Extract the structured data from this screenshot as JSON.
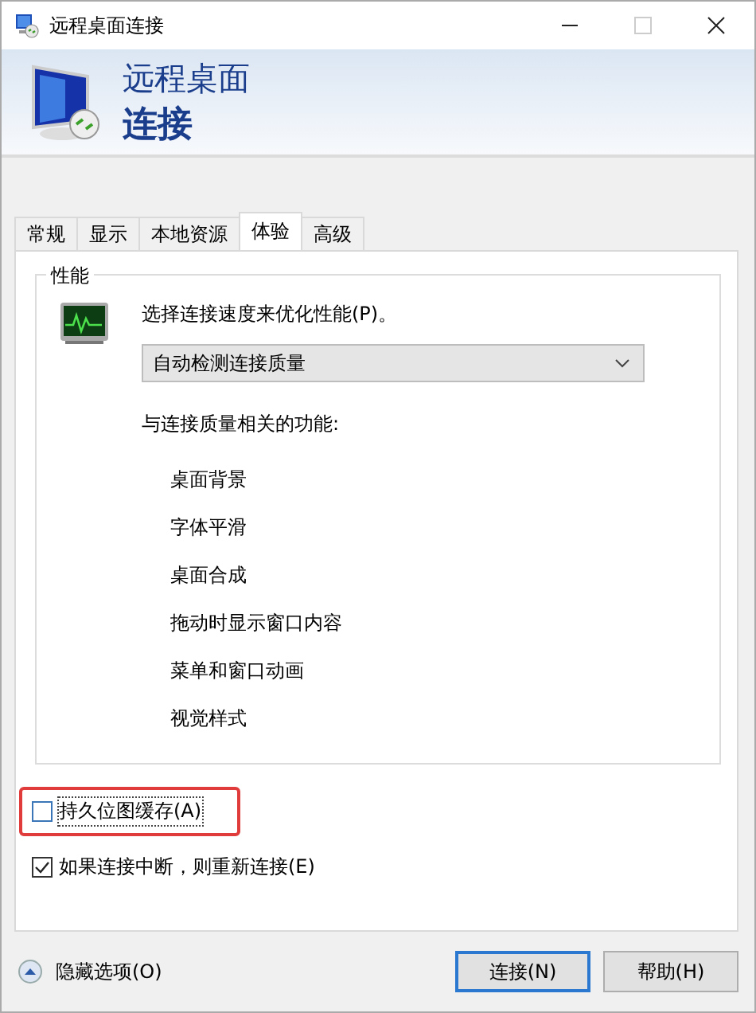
{
  "window": {
    "title": "远程桌面连接"
  },
  "header": {
    "line_1": "远程桌面",
    "line_2": "连接"
  },
  "tabs": [
    {
      "label": "常规",
      "selected": false
    },
    {
      "label": "显示",
      "selected": false
    },
    {
      "label": "本地资源",
      "selected": false
    },
    {
      "label": "体验",
      "selected": true
    },
    {
      "label": "高级",
      "selected": false
    }
  ],
  "performance": {
    "title": "性能",
    "prompt": "选择连接速度来优化性能(P)。",
    "dropdown": {
      "value": "自动检测连接质量"
    },
    "features_label": "与连接质量相关的功能:",
    "features": [
      "桌面背景",
      "字体平滑",
      "桌面合成",
      "拖动时显示窗口内容",
      "菜单和窗口动画",
      "视觉样式"
    ]
  },
  "checkboxes": [
    {
      "label": "持久位图缓存(A)",
      "checked": false,
      "highlighted": true
    },
    {
      "label": "如果连接中断，则重新连接(E)",
      "checked": true,
      "highlighted": false
    }
  ],
  "footer": {
    "toggle": "隐藏选项(O)",
    "buttons": [
      {
        "label": "连接(N)",
        "kind": "default"
      },
      {
        "label": "帮助(H)",
        "kind": "normal"
      }
    ]
  }
}
